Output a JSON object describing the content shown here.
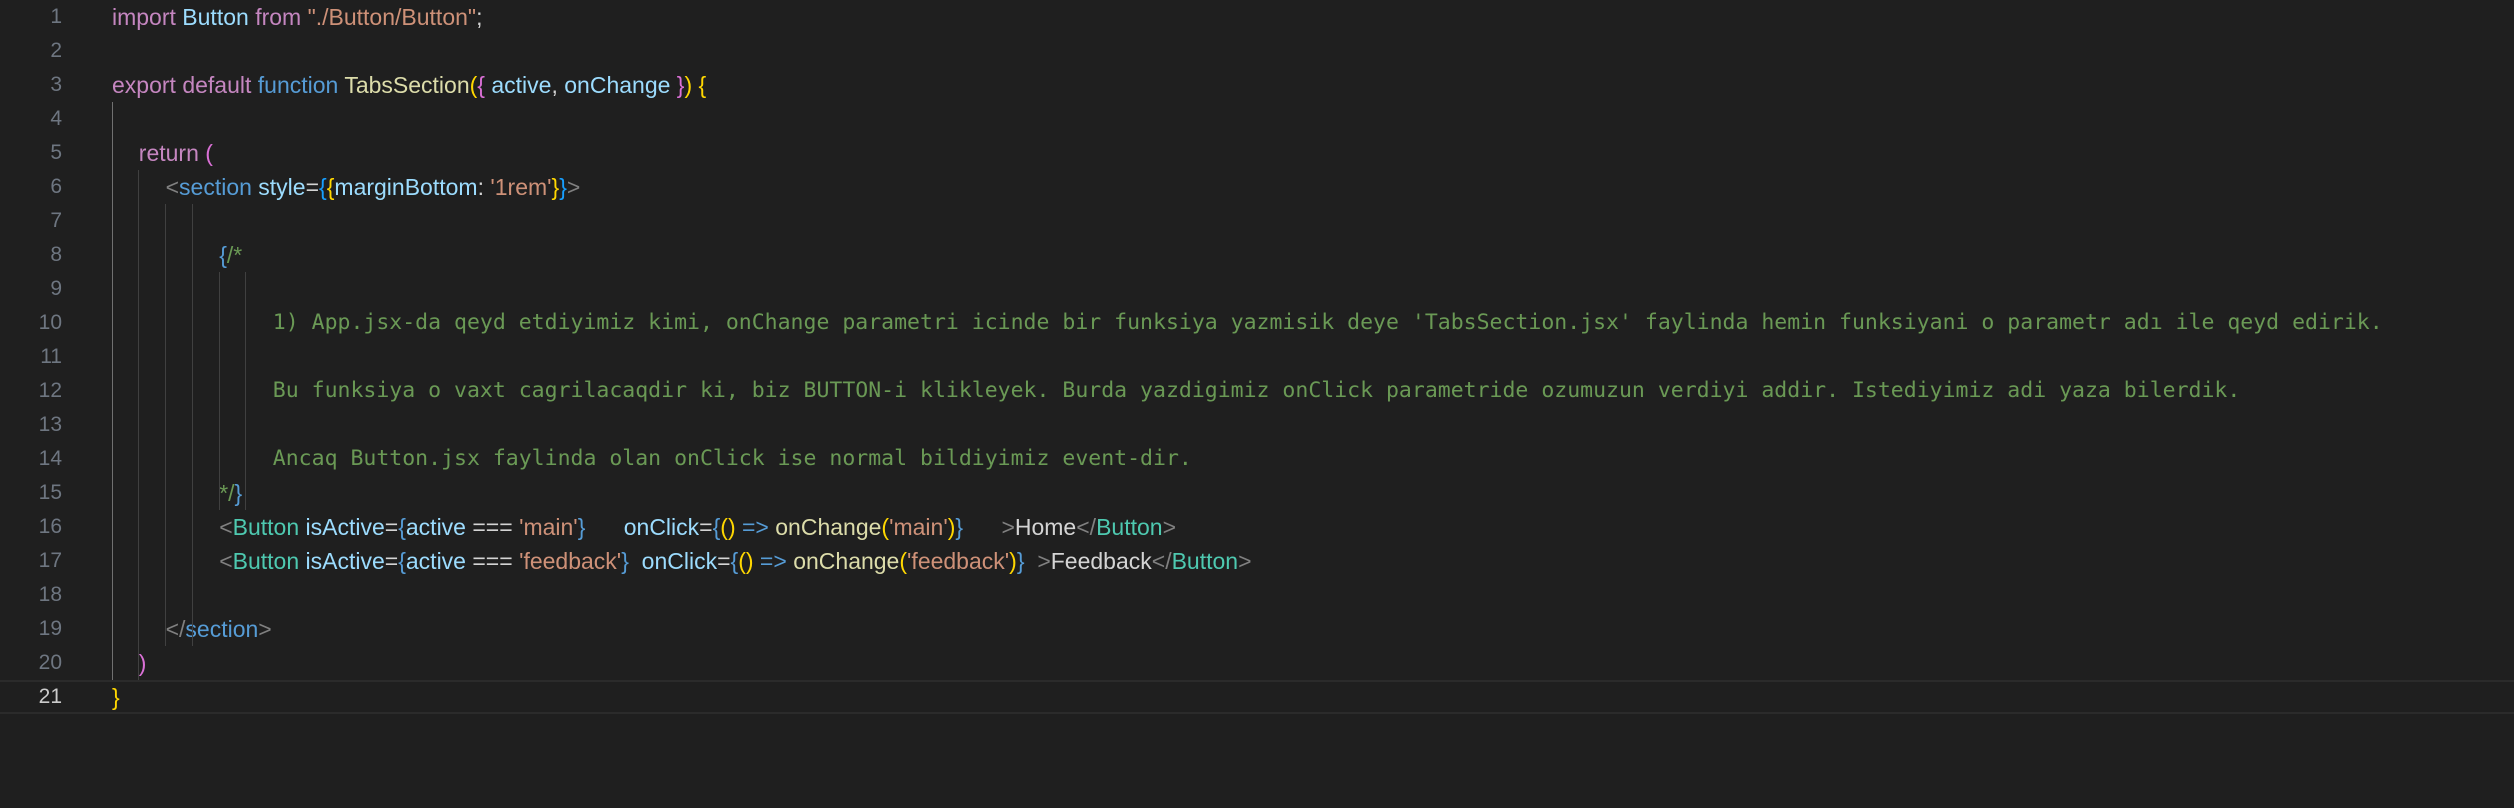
{
  "theme": {
    "background": "#1f1f1f",
    "line_number": "#6e7681",
    "line_number_active": "#cccccc",
    "indent_guide": "#404040",
    "indent_guide_active": "#707070"
  },
  "editor": {
    "language": "jsx",
    "active_line": 21,
    "lines": [
      {
        "n": "1",
        "font": "sans",
        "indent": 0,
        "tokens": [
          {
            "text": "import ",
            "color": "#c586c0"
          },
          {
            "text": "Button ",
            "color": "#9cdcfe"
          },
          {
            "text": "from ",
            "color": "#c586c0"
          },
          {
            "text": "\"./Button/Button\"",
            "color": "#ce9178"
          },
          {
            "text": ";",
            "color": "#d4d4d4"
          }
        ]
      },
      {
        "n": "2",
        "font": "sans",
        "indent": 0,
        "tokens": []
      },
      {
        "n": "3",
        "font": "sans",
        "indent": 0,
        "tokens": [
          {
            "text": "export ",
            "color": "#c586c0"
          },
          {
            "text": "default ",
            "color": "#c586c0"
          },
          {
            "text": "function ",
            "color": "#569cd6"
          },
          {
            "text": "TabsSection",
            "color": "#dcdcaa"
          },
          {
            "text": "(",
            "color": "#ffd700"
          },
          {
            "text": "{ ",
            "color": "#da70d6"
          },
          {
            "text": "active",
            "color": "#9cdcfe"
          },
          {
            "text": ", ",
            "color": "#d4d4d4"
          },
          {
            "text": "onChange ",
            "color": "#9cdcfe"
          },
          {
            "text": "}",
            "color": "#da70d6"
          },
          {
            "text": ")",
            "color": "#ffd700"
          },
          {
            "text": " ",
            "color": "#d4d4d4"
          },
          {
            "text": "{",
            "color": "#ffd700"
          }
        ]
      },
      {
        "n": "4",
        "font": "sans",
        "indent": 0,
        "tokens": []
      },
      {
        "n": "5",
        "font": "sans",
        "indent": 1,
        "tokens": [
          {
            "text": "return ",
            "color": "#c586c0"
          },
          {
            "text": "(",
            "color": "#da70d6"
          }
        ]
      },
      {
        "n": "6",
        "font": "sans",
        "indent": 2,
        "tokens": [
          {
            "text": "<",
            "color": "#808080"
          },
          {
            "text": "section ",
            "color": "#569cd6"
          },
          {
            "text": "style",
            "color": "#9cdcfe"
          },
          {
            "text": "=",
            "color": "#d4d4d4"
          },
          {
            "text": "{",
            "color": "#179fff"
          },
          {
            "text": "{",
            "color": "#ffd700"
          },
          {
            "text": "marginBottom",
            "color": "#9cdcfe"
          },
          {
            "text": ": ",
            "color": "#d4d4d4"
          },
          {
            "text": "'1rem'",
            "color": "#ce9178"
          },
          {
            "text": "}",
            "color": "#ffd700"
          },
          {
            "text": "}",
            "color": "#179fff"
          },
          {
            "text": ">",
            "color": "#808080"
          }
        ]
      },
      {
        "n": "7",
        "font": "sans",
        "indent": 0,
        "tokens": []
      },
      {
        "n": "8",
        "font": "sans",
        "indent": 4,
        "tokens": [
          {
            "text": "{",
            "color": "#569cd6"
          },
          {
            "text": "/*",
            "color": "#6a9955"
          }
        ]
      },
      {
        "n": "9",
        "font": "sans",
        "indent": 0,
        "tokens": []
      },
      {
        "n": "10",
        "font": "mono",
        "indent": 6,
        "tokens": [
          {
            "text": "1) App.jsx-da qeyd etdiyimiz kimi, onChange parametri icinde bir funksiya yazmisik deye 'TabsSection.jsx' faylinda hemin funksiyani o parametr adı ile qeyd edirik.",
            "color": "#6a9955"
          }
        ]
      },
      {
        "n": "11",
        "font": "sans",
        "indent": 0,
        "tokens": []
      },
      {
        "n": "12",
        "font": "mono",
        "indent": 6,
        "tokens": [
          {
            "text": "Bu funksiya o vaxt cagrilacaqdir ki, biz BUTTON-i klikleyek. Burda yazdigimiz onClick parametride ozumuzun verdiyi addir. Istediyimiz adi yaza bilerdik.",
            "color": "#6a9955"
          }
        ]
      },
      {
        "n": "13",
        "font": "sans",
        "indent": 0,
        "tokens": []
      },
      {
        "n": "14",
        "font": "mono",
        "indent": 6,
        "tokens": [
          {
            "text": "Ancaq Button.jsx faylinda olan onClick ise normal bildiyimiz event-dir.",
            "color": "#6a9955"
          }
        ]
      },
      {
        "n": "15",
        "font": "sans",
        "indent": 4,
        "tokens": [
          {
            "text": "*/",
            "color": "#6a9955"
          },
          {
            "text": "}",
            "color": "#569cd6"
          }
        ]
      },
      {
        "n": "16",
        "font": "sans",
        "indent": 4,
        "tokens": [
          {
            "text": "<",
            "color": "#808080"
          },
          {
            "text": "Button ",
            "color": "#4ec9b0"
          },
          {
            "text": "isActive",
            "color": "#9cdcfe"
          },
          {
            "text": "=",
            "color": "#d4d4d4"
          },
          {
            "text": "{",
            "color": "#569cd6"
          },
          {
            "text": "active ",
            "color": "#9cdcfe"
          },
          {
            "text": "=== ",
            "color": "#d4d4d4"
          },
          {
            "text": "'main'",
            "color": "#ce9178"
          },
          {
            "text": "}",
            "color": "#569cd6"
          },
          {
            "text": "      ",
            "color": "#d4d4d4"
          },
          {
            "text": "onClick",
            "color": "#9cdcfe"
          },
          {
            "text": "=",
            "color": "#d4d4d4"
          },
          {
            "text": "{",
            "color": "#569cd6"
          },
          {
            "text": "()",
            "color": "#ffd700"
          },
          {
            "text": " => ",
            "color": "#569cd6"
          },
          {
            "text": "onChange",
            "color": "#dcdcaa"
          },
          {
            "text": "(",
            "color": "#ffd700"
          },
          {
            "text": "'main'",
            "color": "#ce9178"
          },
          {
            "text": ")",
            "color": "#ffd700"
          },
          {
            "text": "}",
            "color": "#569cd6"
          },
          {
            "text": "      ",
            "color": "#d4d4d4"
          },
          {
            "text": ">",
            "color": "#808080"
          },
          {
            "text": "Home",
            "color": "#d4d4d4"
          },
          {
            "text": "</",
            "color": "#808080"
          },
          {
            "text": "Button",
            "color": "#4ec9b0"
          },
          {
            "text": ">",
            "color": "#808080"
          }
        ]
      },
      {
        "n": "17",
        "font": "sans",
        "indent": 4,
        "tokens": [
          {
            "text": "<",
            "color": "#808080"
          },
          {
            "text": "Button ",
            "color": "#4ec9b0"
          },
          {
            "text": "isActive",
            "color": "#9cdcfe"
          },
          {
            "text": "=",
            "color": "#d4d4d4"
          },
          {
            "text": "{",
            "color": "#569cd6"
          },
          {
            "text": "active ",
            "color": "#9cdcfe"
          },
          {
            "text": "=== ",
            "color": "#d4d4d4"
          },
          {
            "text": "'feedback'",
            "color": "#ce9178"
          },
          {
            "text": "}",
            "color": "#569cd6"
          },
          {
            "text": "  ",
            "color": "#d4d4d4"
          },
          {
            "text": "onClick",
            "color": "#9cdcfe"
          },
          {
            "text": "=",
            "color": "#d4d4d4"
          },
          {
            "text": "{",
            "color": "#569cd6"
          },
          {
            "text": "()",
            "color": "#ffd700"
          },
          {
            "text": " => ",
            "color": "#569cd6"
          },
          {
            "text": "onChange",
            "color": "#dcdcaa"
          },
          {
            "text": "(",
            "color": "#ffd700"
          },
          {
            "text": "'feedback'",
            "color": "#ce9178"
          },
          {
            "text": ")",
            "color": "#ffd700"
          },
          {
            "text": "}",
            "color": "#569cd6"
          },
          {
            "text": "  ",
            "color": "#d4d4d4"
          },
          {
            "text": ">",
            "color": "#808080"
          },
          {
            "text": "Feedback",
            "color": "#d4d4d4"
          },
          {
            "text": "</",
            "color": "#808080"
          },
          {
            "text": "Button",
            "color": "#4ec9b0"
          },
          {
            "text": ">",
            "color": "#808080"
          }
        ]
      },
      {
        "n": "18",
        "font": "sans",
        "indent": 0,
        "tokens": []
      },
      {
        "n": "19",
        "font": "sans",
        "indent": 2,
        "tokens": [
          {
            "text": "</",
            "color": "#808080"
          },
          {
            "text": "section",
            "color": "#569cd6"
          },
          {
            "text": ">",
            "color": "#808080"
          }
        ]
      },
      {
        "n": "20",
        "font": "sans",
        "indent": 1,
        "tokens": [
          {
            "text": ")",
            "color": "#da70d6"
          }
        ]
      },
      {
        "n": "21",
        "font": "sans",
        "indent": 0,
        "tokens": [
          {
            "text": "}",
            "color": "#ffd700"
          }
        ]
      }
    ]
  }
}
